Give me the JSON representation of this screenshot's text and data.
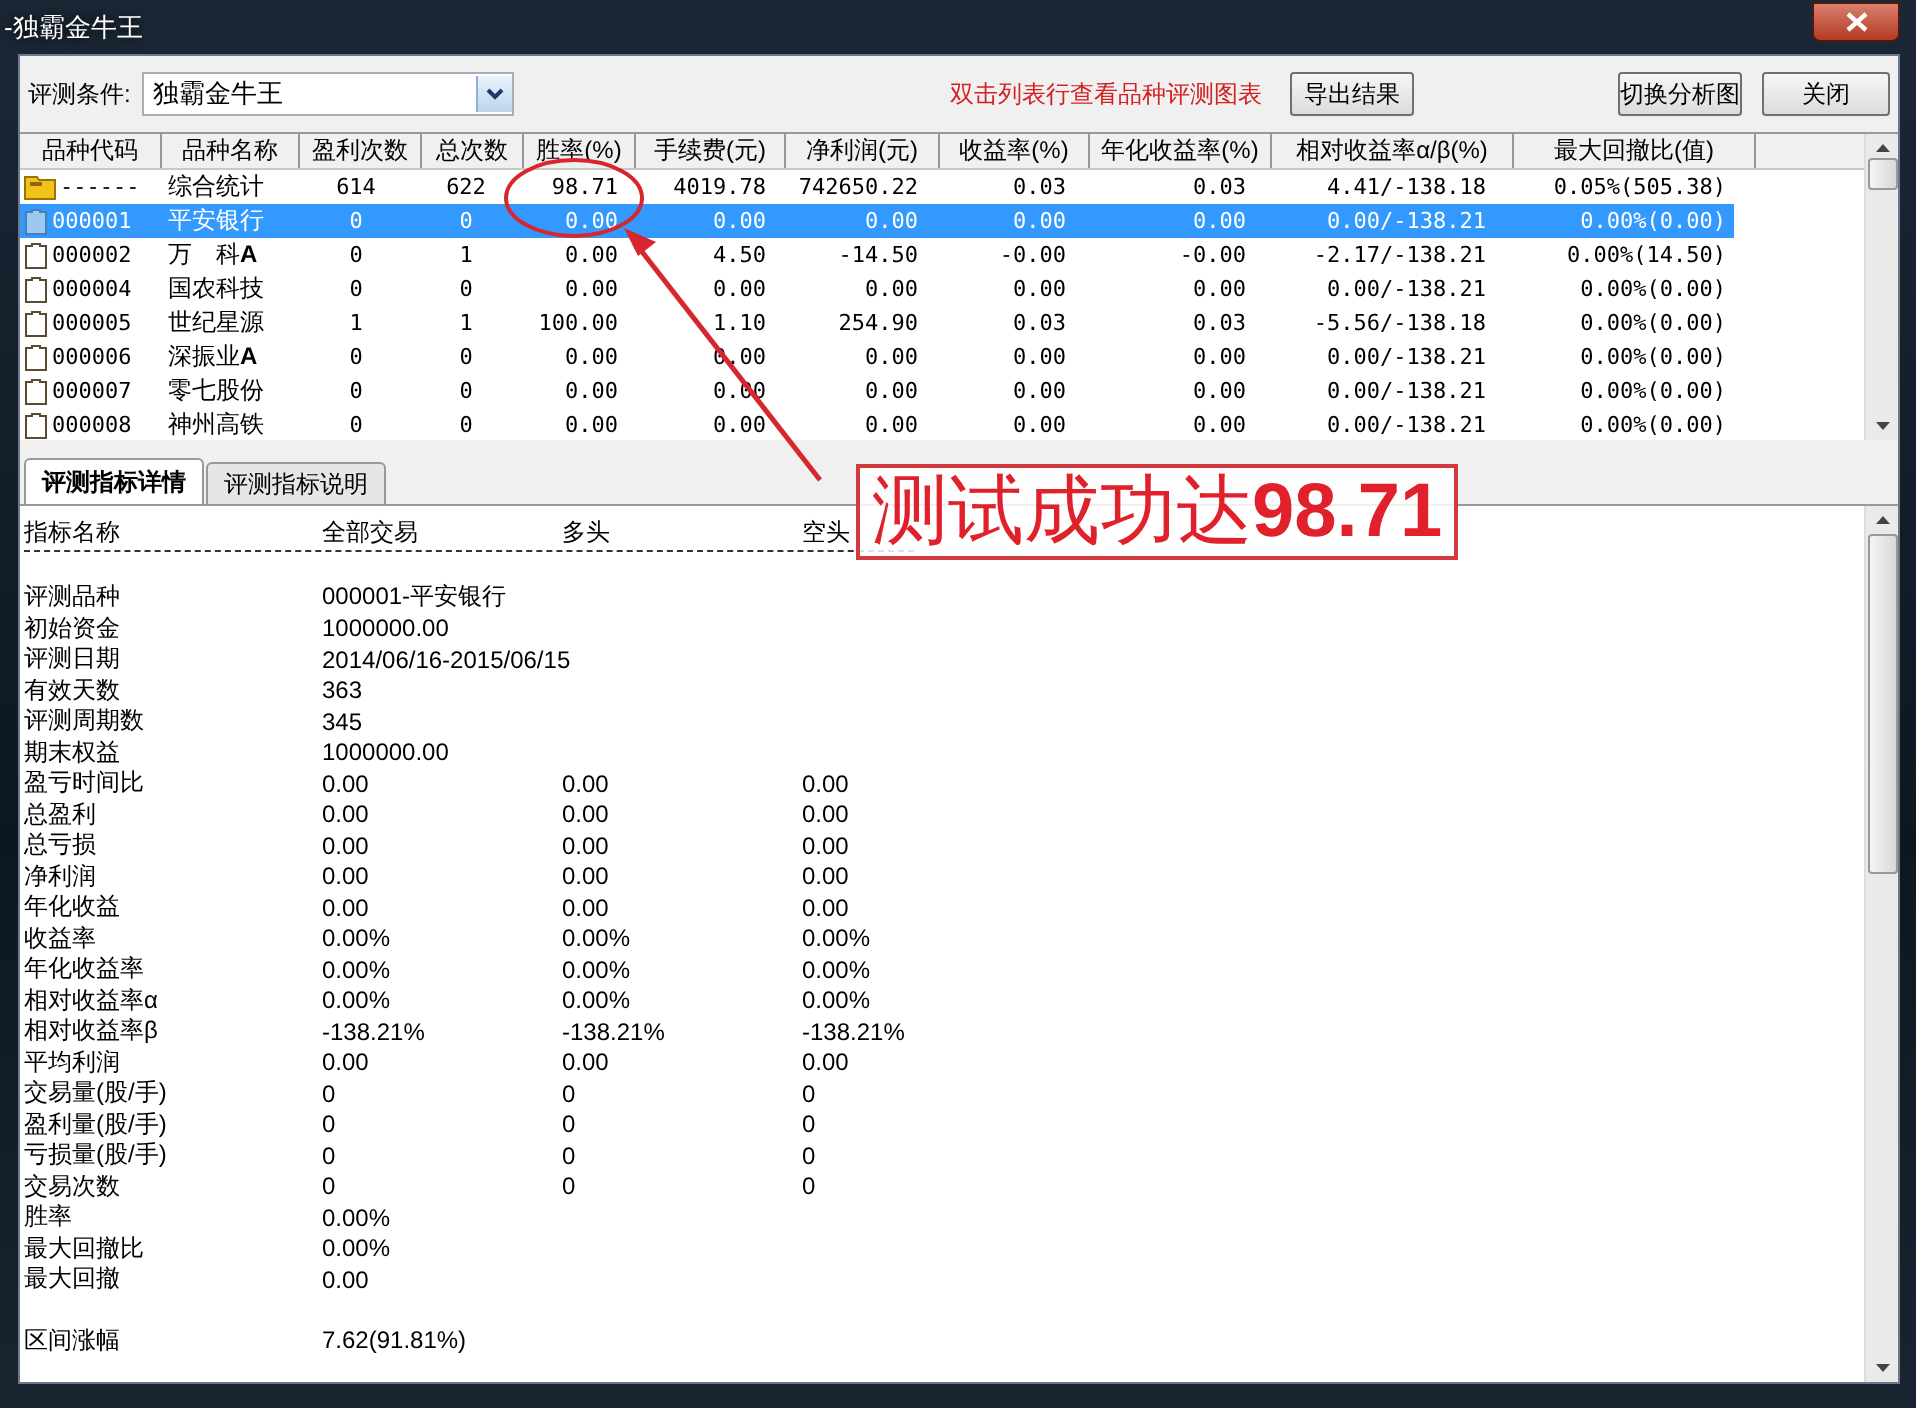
{
  "window": {
    "title": "-独霸金牛王"
  },
  "toolbar": {
    "label": "评测条件:",
    "condition": "独霸金牛王",
    "hint": "双击列表行查看品种评测图表",
    "buttons": [
      "导出结果",
      "切换分析图",
      "关闭"
    ]
  },
  "table": {
    "columns": [
      "品种代码",
      "品种名称",
      "盈利次数",
      "总次数",
      "胜率(%)",
      "手续费(元)",
      "净利润(元)",
      "收益率(%)",
      "年化收益率(%)",
      "相对收益率α/β(%)",
      "最大回撤比(值)"
    ],
    "rows": [
      {
        "kind": "summary",
        "selected": false,
        "cells": [
          "------",
          "综合统计",
          "614",
          "622",
          "98.71",
          "4019.78",
          "742650.22",
          "0.03",
          "0.03",
          "4.41/-138.18",
          "0.05%(505.38)"
        ]
      },
      {
        "kind": "stock",
        "selected": true,
        "cells": [
          "000001",
          "平安银行",
          "0",
          "0",
          "0.00",
          "0.00",
          "0.00",
          "0.00",
          "0.00",
          "0.00/-138.21",
          "0.00%(0.00)"
        ]
      },
      {
        "kind": "stock",
        "selected": false,
        "cells": [
          "000002",
          "万　科**A**",
          "0",
          "1",
          "0.00",
          "4.50",
          "-14.50",
          "-0.00",
          "-0.00",
          "-2.17/-138.21",
          "0.00%(14.50)"
        ]
      },
      {
        "kind": "stock",
        "selected": false,
        "cells": [
          "000004",
          "国农科技",
          "0",
          "0",
          "0.00",
          "0.00",
          "0.00",
          "0.00",
          "0.00",
          "0.00/-138.21",
          "0.00%(0.00)"
        ]
      },
      {
        "kind": "stock",
        "selected": false,
        "cells": [
          "000005",
          "世纪星源",
          "1",
          "1",
          "100.00",
          "1.10",
          "254.90",
          "0.03",
          "0.03",
          "-5.56/-138.18",
          "0.00%(0.00)"
        ]
      },
      {
        "kind": "stock",
        "selected": false,
        "cells": [
          "000006",
          "深振业**A**",
          "0",
          "0",
          "0.00",
          "0.00",
          "0.00",
          "0.00",
          "0.00",
          "0.00/-138.21",
          "0.00%(0.00)"
        ]
      },
      {
        "kind": "stock",
        "selected": false,
        "cells": [
          "000007",
          "零七股份",
          "0",
          "0",
          "0.00",
          "0.00",
          "0.00",
          "0.00",
          "0.00",
          "0.00/-138.21",
          "0.00%(0.00)"
        ]
      },
      {
        "kind": "stock",
        "selected": false,
        "cells": [
          "000008",
          "神州高铁",
          "0",
          "0",
          "0.00",
          "0.00",
          "0.00",
          "0.00",
          "0.00",
          "0.00/-138.21",
          "0.00%(0.00)"
        ]
      }
    ]
  },
  "tabs": [
    {
      "label": "评测指标详情",
      "selected": true
    },
    {
      "label": "评测指标说明",
      "selected": false
    }
  ],
  "details": {
    "columns": [
      "指标名称",
      "全部交易",
      "多头",
      "空头"
    ],
    "rows": [
      {
        "cells": [
          "评测品种",
          "000001-平安银行"
        ]
      },
      {
        "cells": [
          "初始资金",
          "1000000.00"
        ]
      },
      {
        "cells": [
          "评测日期",
          "2014/06/16-2015/06/15"
        ]
      },
      {
        "cells": [
          "有效天数",
          "363"
        ]
      },
      {
        "cells": [
          "评测周期数",
          "345"
        ]
      },
      {
        "cells": [
          "期末权益",
          "1000000.00"
        ]
      },
      {
        "cells": [
          "盈亏时间比",
          "0.00",
          "0.00",
          "0.00"
        ]
      },
      {
        "cells": [
          "总盈利",
          "0.00",
          "0.00",
          "0.00"
        ]
      },
      {
        "cells": [
          "总亏损",
          "0.00",
          "0.00",
          "0.00"
        ]
      },
      {
        "cells": [
          "净利润",
          "0.00",
          "0.00",
          "0.00"
        ]
      },
      {
        "cells": [
          "年化收益",
          "0.00",
          "0.00",
          "0.00"
        ]
      },
      {
        "cells": [
          "收益率",
          "0.00%",
          "0.00%",
          "0.00%"
        ]
      },
      {
        "cells": [
          "年化收益率",
          "0.00%",
          "0.00%",
          "0.00%"
        ]
      },
      {
        "cells": [
          "相对收益率α",
          "0.00%",
          "0.00%",
          "0.00%"
        ]
      },
      {
        "cells": [
          "相对收益率β",
          "-138.21%",
          "-138.21%",
          "-138.21%"
        ]
      },
      {
        "cells": [
          "平均利润",
          "0.00",
          "0.00",
          "0.00"
        ]
      },
      {
        "cells": [
          "交易量(股/手)",
          "0",
          "0",
          "0"
        ]
      },
      {
        "cells": [
          "盈利量(股/手)",
          "0",
          "0",
          "0"
        ]
      },
      {
        "cells": [
          "亏损量(股/手)",
          "0",
          "0",
          "0"
        ]
      },
      {
        "cells": [
          "交易次数",
          "0",
          "0",
          "0"
        ]
      },
      {
        "cells": [
          "胜率",
          "0.00%"
        ]
      },
      {
        "cells": [
          "最大回撤比",
          "0.00%"
        ]
      },
      {
        "cells": [
          "最大回撤",
          "0.00"
        ]
      },
      {
        "kind": "gap",
        "cells": [
          "区间涨幅",
          "7.62(91.81%)"
        ]
      }
    ]
  },
  "annotation": {
    "text": "测试成功达**98.71**"
  }
}
